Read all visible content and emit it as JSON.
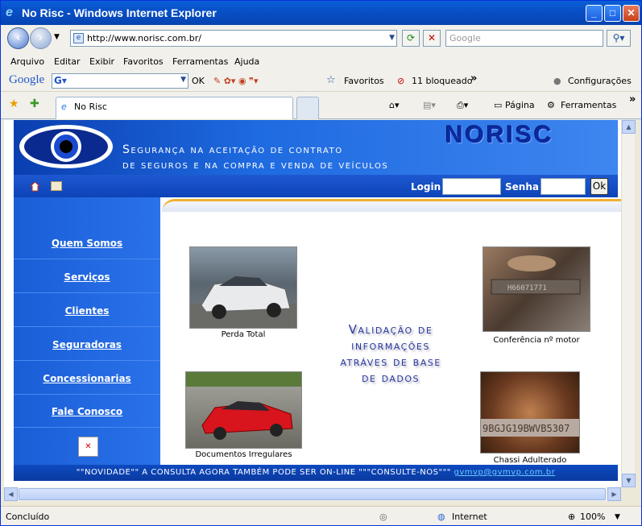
{
  "window": {
    "title": "No Risc - Windows Internet Explorer",
    "minimize": "_",
    "maximize": "□",
    "close": "✕"
  },
  "address": {
    "url": "http://www.norisc.com.br/",
    "search_placeholder": "Google"
  },
  "menu": [
    "Arquivo",
    "Editar",
    "Exibir",
    "Favoritos",
    "Ferramentas",
    "Ajuda"
  ],
  "google_toolbar": {
    "logo": "Google",
    "ok": "OK",
    "favoritos": "Favoritos",
    "bloqueado": "11 bloqueado",
    "more": "»",
    "configuracoes": "Configurações"
  },
  "tabs": {
    "active": "No Risc",
    "pagina": "Página",
    "ferramentas": "Ferramentas",
    "more": "»"
  },
  "site": {
    "brand": "NORISC",
    "tagline1": "Segurança na aceitação de contrato",
    "tagline2": "de seguros e na compra e venda de veículos",
    "login_label": "Login",
    "senha_label": "Senha",
    "ok_button": "Ok",
    "nav": [
      "Quem Somos",
      "Serviços",
      "Clientes",
      "Seguradoras",
      "Concessionarias",
      "Fale Conosco"
    ],
    "captions": {
      "perda": "Perda Total",
      "motor": "Conferência nº motor",
      "docs": "Documentos Irregulares",
      "chassi": "Chassi Adulterado"
    },
    "chassi_text": "9BGJG19BWVB5307",
    "middle": [
      "Validação de",
      "informações",
      "atráves de base",
      "de dados"
    ],
    "footer_text": "\"\"NOVIDADE\"\" A CONSULTA AGORA TAMBÉM PODE SER ON-LINE \"\"\"CONSULTE-NOS\"\"\" ",
    "footer_link": "gvmvp@gvmvp.com.br"
  },
  "status": {
    "left": "Concluído",
    "zone": "Internet",
    "zoom": "100%"
  }
}
